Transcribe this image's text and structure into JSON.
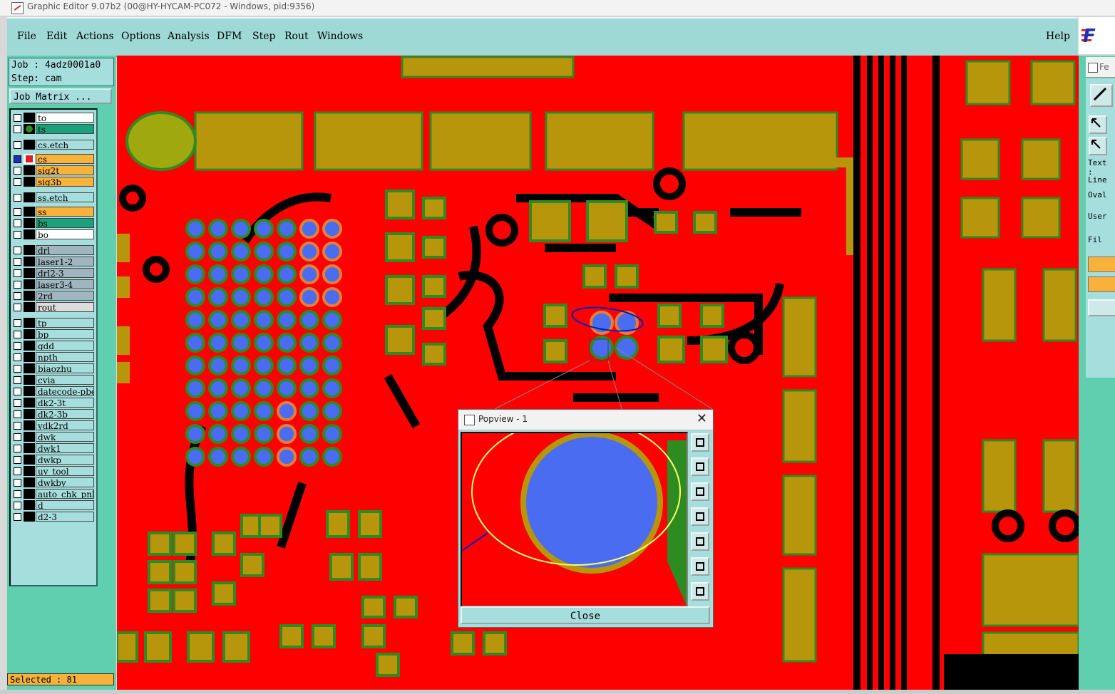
{
  "window": {
    "title": "Graphic Editor 9.07b2 (00@HY-HYCAM-PC072 - Windows, pid:9356)"
  },
  "menu": {
    "items": [
      "File",
      "Edit",
      "Actions",
      "Options",
      "Analysis",
      "DFM",
      "Step",
      "Rout",
      "Windows"
    ],
    "help": "Help"
  },
  "logo": {
    "text": "F"
  },
  "job": {
    "job_label": "Job : 4adz0001a0",
    "step_label": "Step: cam",
    "matrix_button": "Job Matrix ..."
  },
  "layers": [
    {
      "name": "to",
      "color": "#ffffff"
    },
    {
      "name": "ts",
      "color": "#1aa37a"
    },
    {
      "name": "cs.etch",
      "color": "#a6dedd"
    },
    {
      "name": "cs",
      "color": "#f8b23b"
    },
    {
      "name": "sig2t",
      "color": "#f8b23b"
    },
    {
      "name": "sig3b",
      "color": "#f8b23b"
    },
    {
      "name": "ss.etch",
      "color": "#a6dedd"
    },
    {
      "name": "ss",
      "color": "#f8b23b"
    },
    {
      "name": "bs",
      "color": "#1aa37a"
    },
    {
      "name": "bo",
      "color": "#ffffff"
    },
    {
      "name": "drl",
      "color": "#9fb5c0"
    },
    {
      "name": "laser1-2",
      "color": "#9fb5c0"
    },
    {
      "name": "drl2-3",
      "color": "#9fb5c0"
    },
    {
      "name": "laser3-4",
      "color": "#9fb5c0"
    },
    {
      "name": "2rd",
      "color": "#9fb5c0"
    },
    {
      "name": "rout",
      "color": "#dcdcdc"
    },
    {
      "name": "tp",
      "color": "#a6dedd"
    },
    {
      "name": "bp",
      "color": "#a6dedd"
    },
    {
      "name": "gdd",
      "color": "#a6dedd"
    },
    {
      "name": "npth",
      "color": "#a6dedd"
    },
    {
      "name": "biaozhu",
      "color": "#a6dedd"
    },
    {
      "name": "cvia",
      "color": "#a6dedd"
    },
    {
      "name": "datecode-pbe",
      "color": "#a6dedd"
    },
    {
      "name": "dk2-3t",
      "color": "#a6dedd"
    },
    {
      "name": "dk2-3b",
      "color": "#a6dedd"
    },
    {
      "name": "ydk2rd",
      "color": "#a6dedd"
    },
    {
      "name": "dwk",
      "color": "#a6dedd"
    },
    {
      "name": "dwk1",
      "color": "#a6dedd"
    },
    {
      "name": "dwkp",
      "color": "#a6dedd"
    },
    {
      "name": "uv_tool",
      "color": "#a6dedd"
    },
    {
      "name": "dwkby",
      "color": "#a6dedd"
    },
    {
      "name": "auto_chk_pnl",
      "color": "#a6dedd"
    },
    {
      "name": "d",
      "color": "#a6dedd"
    },
    {
      "name": "d2-3",
      "color": "#a6dedd"
    }
  ],
  "status": {
    "selected": "Selected : 81"
  },
  "right_panel": {
    "window_title": "Fe",
    "text_label": "Text :",
    "line_label": "Line",
    "oval_label": "Oval",
    "user_label": "User",
    "fill_label": "Fil"
  },
  "popview": {
    "title": "Popview - 1",
    "close_label": "Close",
    "close_x": "✕"
  },
  "colors": {
    "board": "#ff0000",
    "pad": "#b8960c",
    "via": "#4a6cf0",
    "mask": "#2e8b22",
    "trace": "#000000"
  }
}
